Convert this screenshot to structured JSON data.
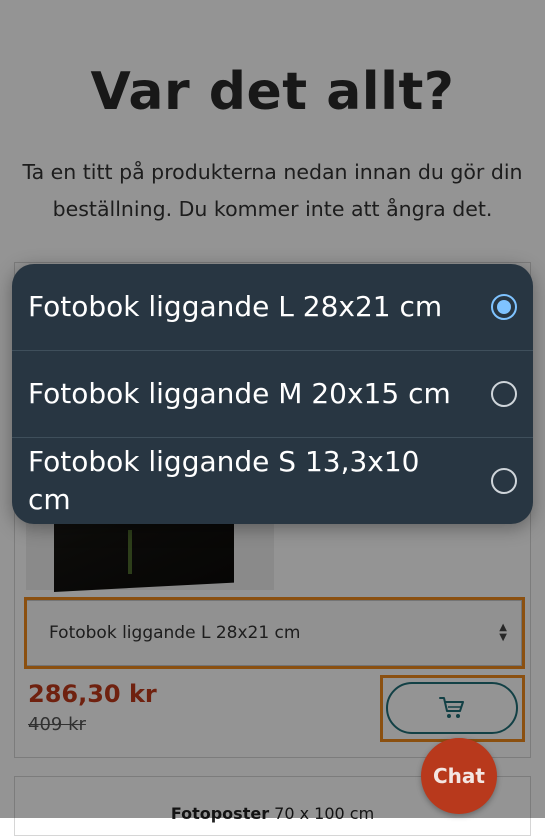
{
  "page": {
    "title": "Var det allt?",
    "subtitle": "Ta en titt på produkterna nedan innan du gör din beställning. Du kommer inte att ångra det."
  },
  "product": {
    "selected_variant": "Fotobok liggande L 28x21 cm",
    "price": "286,30 kr",
    "old_price": "409 kr",
    "cart_icon": "shopping-cart-icon"
  },
  "next_product": {
    "title_bold": "Fotoposter",
    "title_rest": " 70 x 100 cm"
  },
  "chat": {
    "label": "Chat"
  },
  "dropdown": {
    "options": [
      {
        "label": "Fotobok liggande L 28x21 cm",
        "selected": true
      },
      {
        "label": "Fotobok liggande M 20x15 cm",
        "selected": false
      },
      {
        "label": "Fotobok liggande S 13,3x10 cm",
        "selected": false
      }
    ]
  },
  "colors": {
    "price": "#c0391b",
    "accent": "#1f6f78",
    "highlight": "#f08a1c",
    "dropdown_bg": "#283642",
    "radio_selected": "#7fc3ff",
    "chat_bg": "#b8391c"
  }
}
